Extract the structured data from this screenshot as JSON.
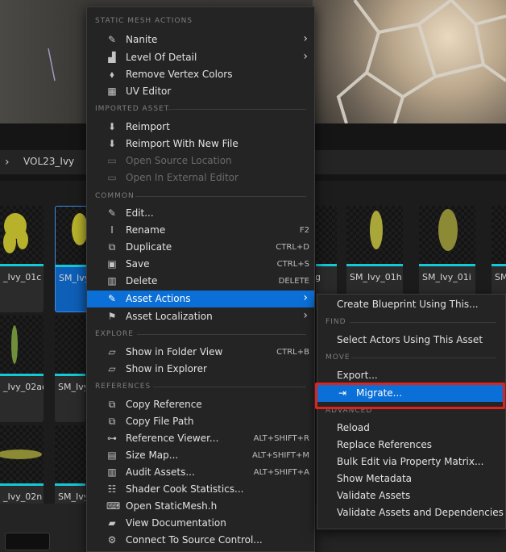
{
  "breadcrumb": {
    "current": "VOL23_Ivy"
  },
  "assets": [
    {
      "name": "_Ivy_01c"
    },
    {
      "name": "SM_Ivy"
    },
    {
      "name": "g"
    },
    {
      "name": "SM_Ivy_01h"
    },
    {
      "name": "SM_Ivy_01i"
    },
    {
      "name": "SM"
    },
    {
      "name": "_Ivy_02ad"
    },
    {
      "name": "SM_Ivy"
    },
    {
      "name": "_Ivy_02n"
    },
    {
      "name": "SM_Ivy"
    }
  ],
  "context_menu": {
    "sections": {
      "static_mesh": "STATIC MESH ACTIONS",
      "imported": "IMPORTED ASSET",
      "common": "COMMON",
      "explore": "EXPLORE",
      "references": "REFERENCES"
    },
    "items": {
      "nanite": "Nanite",
      "lod": "Level Of Detail",
      "remove_vertex_colors": "Remove Vertex Colors",
      "uv_editor": "UV Editor",
      "reimport": "Reimport",
      "reimport_new": "Reimport With New File",
      "open_source": "Open Source Location",
      "open_external": "Open In External Editor",
      "edit": "Edit...",
      "rename": "Rename",
      "duplicate": "Duplicate",
      "save": "Save",
      "delete": "Delete",
      "asset_actions": "Asset Actions",
      "asset_localization": "Asset Localization",
      "show_folder": "Show in Folder View",
      "show_explorer": "Show in Explorer",
      "copy_reference": "Copy Reference",
      "copy_file_path": "Copy File Path",
      "reference_viewer": "Reference Viewer...",
      "size_map": "Size Map...",
      "audit_assets": "Audit Assets...",
      "shader_cook": "Shader Cook Statistics...",
      "open_header": "Open StaticMesh.h",
      "view_docs": "View Documentation",
      "connect_source": "Connect To Source Control..."
    },
    "shortcuts": {
      "rename": "F2",
      "duplicate": "CTRL+D",
      "save": "CTRL+S",
      "delete": "DELETE",
      "show_folder": "CTRL+B",
      "reference_viewer": "ALT+SHIFT+R",
      "size_map": "ALT+SHIFT+M",
      "audit_assets": "ALT+SHIFT+A"
    },
    "highlighted": "asset_actions"
  },
  "submenu": {
    "sections": {
      "find": "FIND",
      "move": "MOVE",
      "advanced": "ADVANCED"
    },
    "items": {
      "create_blueprint": "Create Blueprint Using This...",
      "select_actors": "Select Actors Using This Asset",
      "export": "Export...",
      "migrate": "Migrate...",
      "reload": "Reload",
      "replace_refs": "Replace References",
      "bulk_edit": "Bulk Edit via Property Matrix...",
      "show_metadata": "Show Metadata",
      "validate": "Validate Assets",
      "validate_deps": "Validate Assets and Dependencies"
    },
    "highlighted": "migrate"
  },
  "colors": {
    "accent": "#0a6fd6",
    "annotation": "#e0221d",
    "asset_bar": "#16c7d6"
  }
}
